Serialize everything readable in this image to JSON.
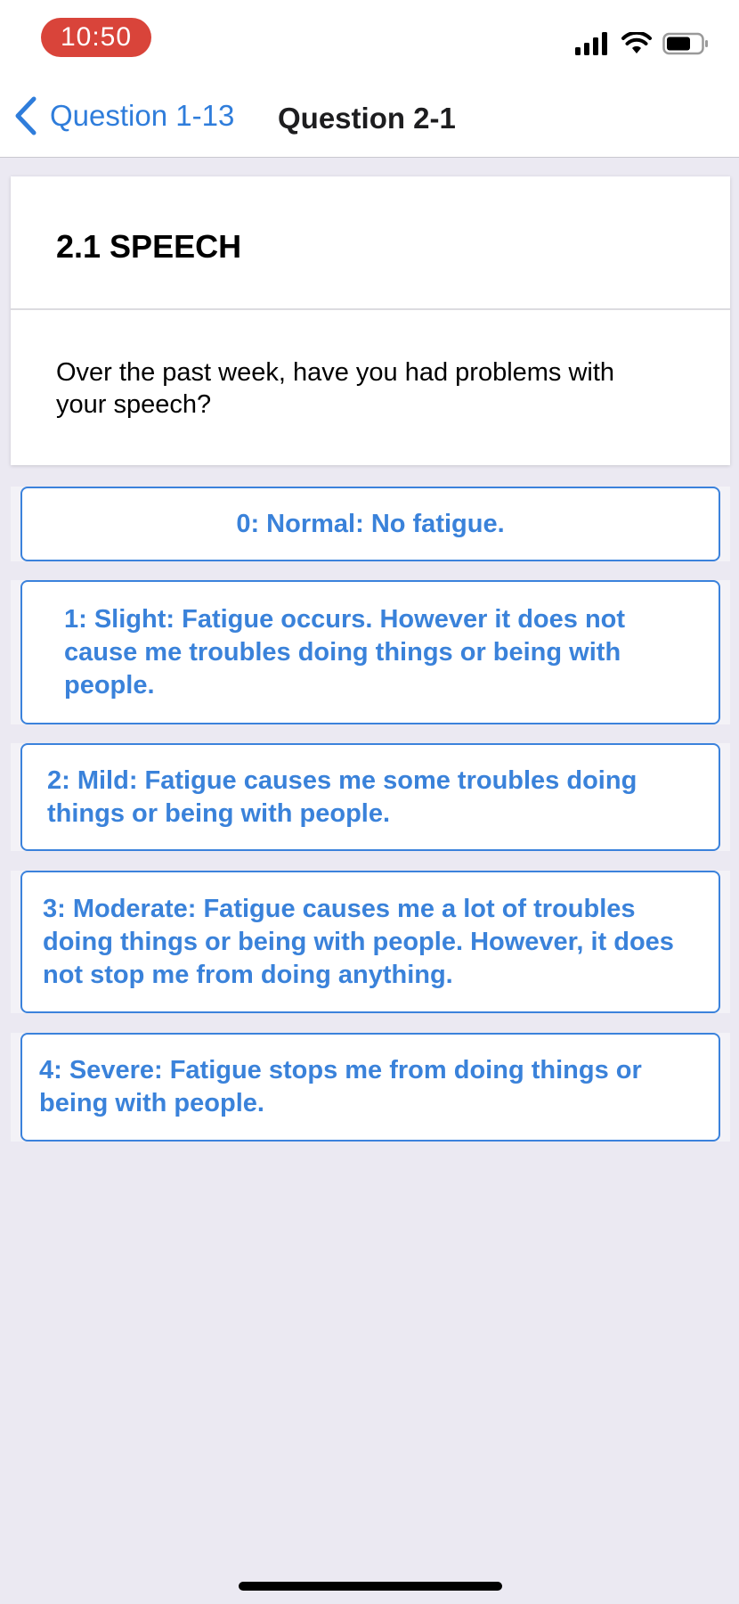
{
  "status_bar": {
    "time": "10:50",
    "icons": [
      "signal-icon",
      "wifi-icon",
      "battery-icon"
    ]
  },
  "nav": {
    "back_label": "Question 1-13",
    "title": "Question 2-1"
  },
  "question": {
    "heading": "2.1 SPEECH",
    "text": "Over the past week, have you had problems with your speech?"
  },
  "answers": [
    {
      "label": "0: Normal: No fatigue."
    },
    {
      "label": "1: Slight: Fatigue occurs. However it does not cause me troubles doing things or being with people."
    },
    {
      "label": "2: Mild: Fatigue causes me some troubles doing things or being with people."
    },
    {
      "label": "3: Moderate: Fatigue causes me a lot of troubles doing things or being with people. However, it does not stop me from doing anything."
    },
    {
      "label": "4: Severe: Fatigue stops me from doing things or being with people."
    }
  ],
  "colors": {
    "accent": "#3a82da",
    "time_pill": "#d9443a",
    "background": "#ebe9f2"
  }
}
